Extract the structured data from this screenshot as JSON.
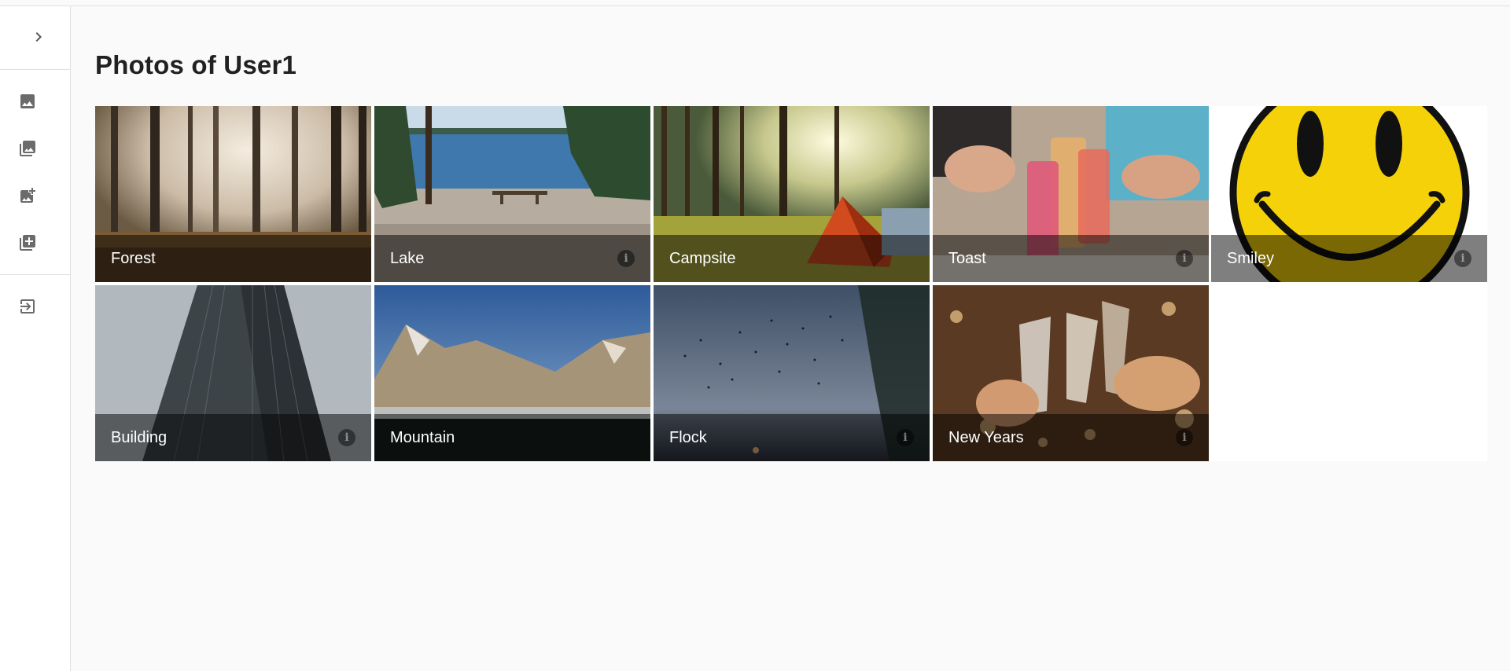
{
  "page": {
    "title": "Photos of User1"
  },
  "sidebar": {
    "toggle_icon": "chevron-right-icon",
    "items": [
      {
        "name": "photo",
        "icon": "image-icon"
      },
      {
        "name": "photo-library",
        "icon": "photo-library-icon"
      },
      {
        "name": "add-photo",
        "icon": "add-photo-icon"
      },
      {
        "name": "add-to-library",
        "icon": "library-add-icon"
      },
      {
        "name": "login",
        "icon": "login-icon"
      }
    ]
  },
  "photos": [
    {
      "label": "Forest",
      "info_icon": "info-icon"
    },
    {
      "label": "Lake",
      "info_icon": "info-icon"
    },
    {
      "label": "Campsite",
      "info_icon": "info-icon"
    },
    {
      "label": "Toast",
      "info_icon": "info-icon"
    },
    {
      "label": "Smiley",
      "info_icon": "info-icon"
    },
    {
      "label": "Building",
      "info_icon": "info-icon"
    },
    {
      "label": "Mountain",
      "info_icon": "info-icon"
    },
    {
      "label": "Flock",
      "info_icon": "info-icon"
    },
    {
      "label": "New Years",
      "info_icon": "info-icon"
    }
  ],
  "colors": {
    "accent_smiley": "#f5d10a",
    "overlay": "#00000080"
  }
}
